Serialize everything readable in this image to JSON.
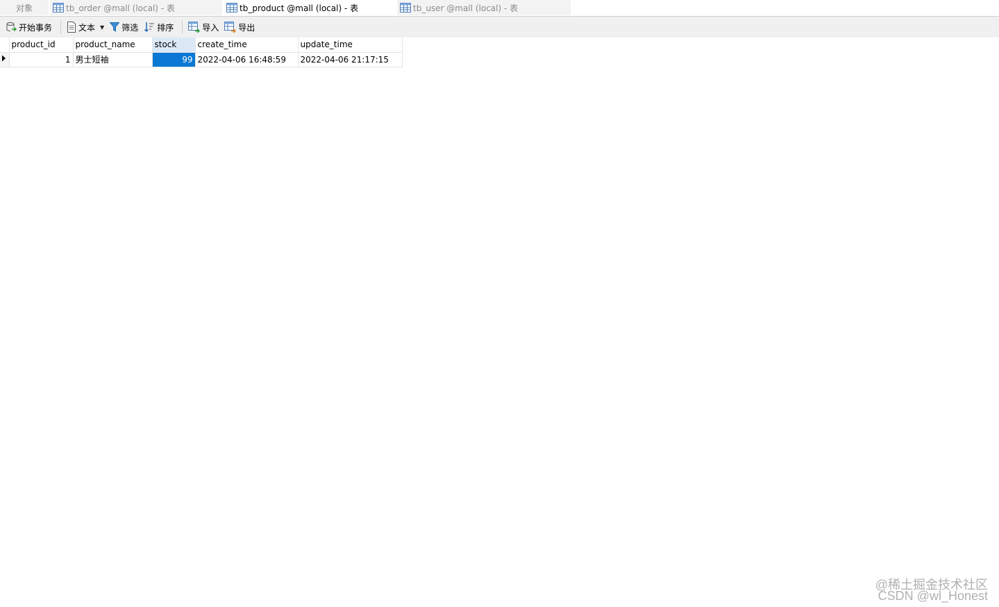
{
  "tabs": [
    {
      "label": "对象",
      "active": false
    },
    {
      "label": "tb_order @mall (local) - 表",
      "active": false
    },
    {
      "label": "tb_product @mall (local) - 表",
      "active": true
    },
    {
      "label": "tb_user @mall (local) - 表",
      "active": false
    }
  ],
  "toolbar": {
    "begin_transaction": "开始事务",
    "text": "文本",
    "filter": "筛选",
    "sort": "排序",
    "import": "导入",
    "export": "导出"
  },
  "grid": {
    "columns": [
      "product_id",
      "product_name",
      "stock",
      "create_time",
      "update_time"
    ],
    "rows": [
      {
        "product_id": "1",
        "product_name": "男士短袖",
        "stock": "99",
        "create_time": "2022-04-06 16:48:59",
        "update_time": "2022-04-06 21:17:15"
      }
    ],
    "selected_column": "stock"
  },
  "watermark": {
    "line1": "@稀土掘金技术社区",
    "line2": "CSDN @wl_Honest"
  },
  "colors": {
    "selected_cell": "#0a78d4",
    "selected_header": "#dbe9f7",
    "toolbar_bg": "#f0f0f0"
  }
}
